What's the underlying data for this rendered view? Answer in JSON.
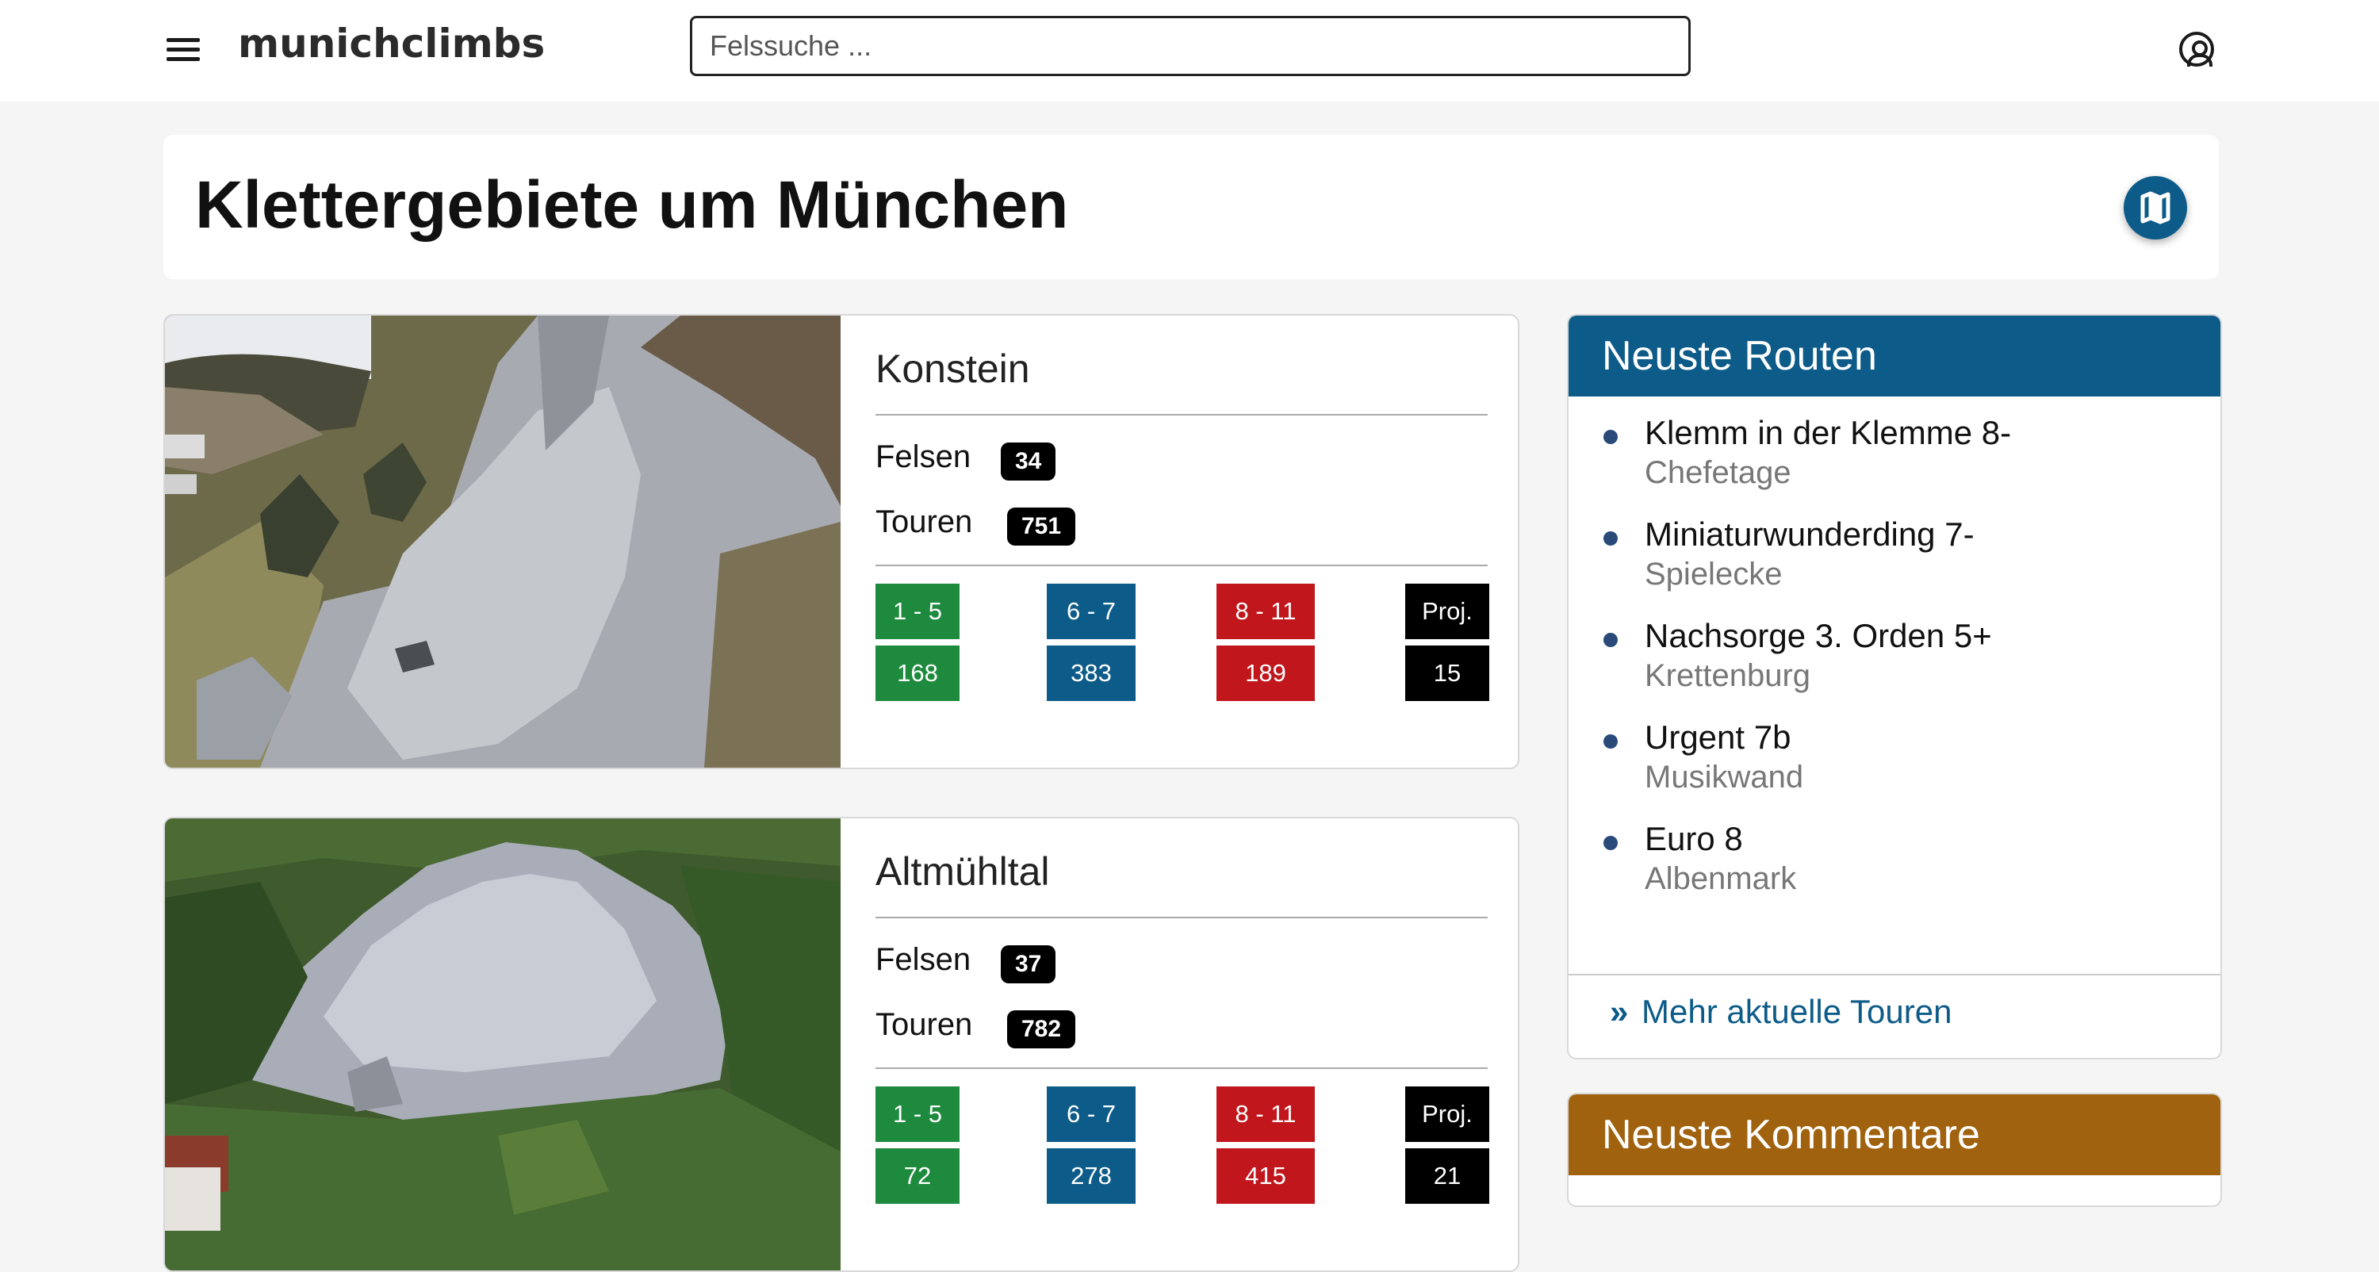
{
  "app": {
    "logo": "munichclimbs"
  },
  "search": {
    "placeholder": "Felssuche ..."
  },
  "icons": {
    "menu": "hamburger-icon",
    "account": "account-icon",
    "map": "map-icon",
    "more": "double-chevron-right-icon"
  },
  "page": {
    "title": "Klettergebiete um München"
  },
  "areas": [
    {
      "name": "Konstein",
      "felsen_label": "Felsen",
      "felsen": "34",
      "touren_label": "Touren",
      "touren": "751",
      "grades": [
        {
          "label": "1 - 5",
          "count": "168",
          "color": "#1e8a3e"
        },
        {
          "label": "6 - 7",
          "count": "383",
          "color": "#0d5b88"
        },
        {
          "label": "8 - 11",
          "count": "189",
          "color": "#c0161c"
        },
        {
          "label": "Proj.",
          "count": "15",
          "color": "#000000"
        }
      ]
    },
    {
      "name": "Altmühltal",
      "felsen_label": "Felsen",
      "felsen": "37",
      "touren_label": "Touren",
      "touren": "782",
      "grades": [
        {
          "label": "1 - 5",
          "count": "72",
          "color": "#1e8a3e"
        },
        {
          "label": "6 - 7",
          "count": "278",
          "color": "#0d5b88"
        },
        {
          "label": "8 - 11",
          "count": "415",
          "color": "#c0161c"
        },
        {
          "label": "Proj.",
          "count": "21",
          "color": "#000000"
        }
      ]
    }
  ],
  "sidebar": {
    "routes_title": "Neuste Routen",
    "routes_color": "#0d5b88",
    "routes": [
      {
        "name": "Klemm in der Klemme 8-",
        "rock": "Chefetage"
      },
      {
        "name": "Miniaturwunderding 7-",
        "rock": "Spielecke"
      },
      {
        "name": "Nachsorge 3. Orden 5+",
        "rock": "Krettenburg"
      },
      {
        "name": "Urgent 7b",
        "rock": "Musikwand"
      },
      {
        "name": "Euro 8",
        "rock": "Albenmark"
      }
    ],
    "more_label": "Mehr aktuelle Touren",
    "comments_title": "Neuste Kommentare",
    "comments_color": "#a0620e"
  }
}
